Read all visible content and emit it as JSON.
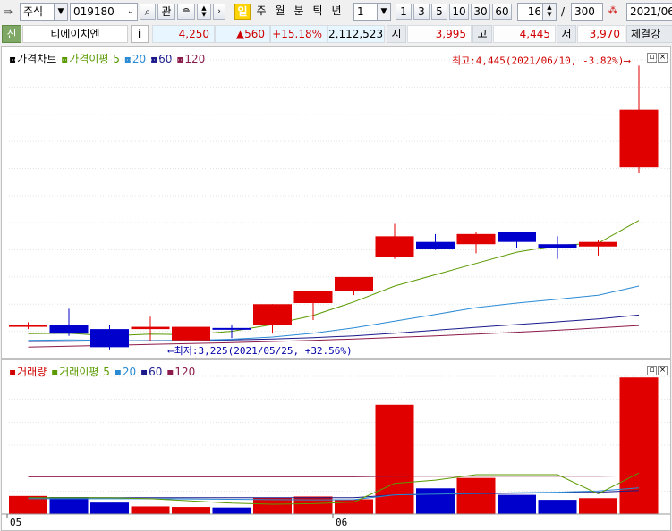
{
  "toolbar": {
    "market": "주식",
    "code": "019180",
    "watch_label": "관",
    "period_active": "일",
    "periods": [
      "주",
      "월",
      "분",
      "틱",
      "년"
    ],
    "unit_value": "1",
    "intervals": [
      "1",
      "3",
      "5",
      "10",
      "30",
      "60"
    ],
    "zoom_value": "16",
    "separator": "/",
    "count_value": "300",
    "date_value": "2021/06/"
  },
  "infobar": {
    "tag": "신",
    "stock_name": "티에이치엔",
    "info_label": "i",
    "price": "4,250",
    "change": "▲560",
    "change_pct": "+15.18%",
    "volume": "2,112,523",
    "open_label": "시",
    "open": "3,995",
    "high_label": "고",
    "high": "4,445",
    "low_label": "저",
    "low": "3,970",
    "trade_label": "체결강"
  },
  "price_pane": {
    "legend_title": "가격차트",
    "legend_ma_title": "가격이평",
    "ma_periods": [
      "5",
      "20",
      "60",
      "120"
    ],
    "high_annotation": "최고:4,445(2021/06/10, -3.82%)",
    "low_annotation": "최저:3,225(2021/05/25, +32.56%)"
  },
  "volume_pane": {
    "legend_title": "거래량",
    "legend_ma_title": "거래이평",
    "ma_periods": [
      "5",
      "20",
      "60",
      "120"
    ]
  },
  "colors": {
    "up": "#e00000",
    "down": "#0000cc",
    "ma5": "#5a9a00",
    "ma20": "#2a8ad4",
    "ma60": "#1a1a8c",
    "ma120": "#8c1a4a"
  },
  "chart_data": {
    "type": "candlestick",
    "x_axis_labels": [
      "05",
      "06"
    ],
    "x_axis_label_at": [
      0,
      8
    ],
    "candles": [
      {
        "open": 3290,
        "high": 3310,
        "low": 3280,
        "close": 3300
      },
      {
        "open": 3300,
        "high": 3370,
        "low": 3250,
        "close": 3260
      },
      {
        "open": 3280,
        "high": 3300,
        "low": 3190,
        "close": 3200
      },
      {
        "open": 3280,
        "high": 3335,
        "low": 3225,
        "close": 3290
      },
      {
        "open": 3230,
        "high": 3330,
        "low": 3180,
        "close": 3290
      },
      {
        "open": 3285,
        "high": 3300,
        "low": 3240,
        "close": 3280
      },
      {
        "open": 3300,
        "high": 3370,
        "low": 3260,
        "close": 3390
      },
      {
        "open": 3395,
        "high": 3435,
        "low": 3320,
        "close": 3450
      },
      {
        "open": 3450,
        "high": 3510,
        "low": 3430,
        "close": 3510
      },
      {
        "open": 3600,
        "high": 3745,
        "low": 3590,
        "close": 3690
      },
      {
        "open": 3665,
        "high": 3700,
        "low": 3630,
        "close": 3635
      },
      {
        "open": 3655,
        "high": 3710,
        "low": 3615,
        "close": 3700
      },
      {
        "open": 3710,
        "high": 3700,
        "low": 3640,
        "close": 3665
      },
      {
        "open": 3655,
        "high": 3690,
        "low": 3590,
        "close": 3640
      },
      {
        "open": 3645,
        "high": 3675,
        "low": 3605,
        "close": 3665
      },
      {
        "open": 3995,
        "high": 4445,
        "low": 3970,
        "close": 4250
      }
    ],
    "ma": {
      "5": [
        3260,
        3262,
        3250,
        3258,
        3255,
        3270,
        3300,
        3340,
        3400,
        3470,
        3520,
        3570,
        3620,
        3650,
        3660,
        3760
      ],
      "20": [
        3230,
        3232,
        3230,
        3228,
        3230,
        3235,
        3245,
        3262,
        3285,
        3315,
        3345,
        3375,
        3395,
        3412,
        3430,
        3470
      ],
      "60": [
        3225,
        3226,
        3228,
        3229,
        3230,
        3232,
        3236,
        3242,
        3250,
        3262,
        3275,
        3288,
        3300,
        3312,
        3325,
        3342
      ],
      "120": [
        3200,
        3204,
        3208,
        3212,
        3216,
        3220,
        3225,
        3230,
        3236,
        3243,
        3250,
        3258,
        3266,
        3275,
        3285,
        3296
      ]
    },
    "volume": [
      165000,
      155000,
      105000,
      70000,
      65000,
      60000,
      150000,
      160000,
      135000,
      1000000,
      235000,
      330000,
      175000,
      130000,
      145000,
      1250000
    ],
    "volume_ma": {
      "5": [
        150000,
        150000,
        150000,
        140000,
        120000,
        100000,
        90000,
        95000,
        110000,
        280000,
        310000,
        360000,
        360000,
        360000,
        185000,
        375000
      ],
      "20": [
        140000,
        140000,
        140000,
        140000,
        138000,
        135000,
        132000,
        130000,
        132000,
        175000,
        182000,
        188000,
        195000,
        200000,
        210000,
        240000
      ],
      "60": [
        150000,
        150000,
        150000,
        150000,
        150000,
        150000,
        150000,
        150000,
        150000,
        175000,
        180000,
        185000,
        190000,
        195000,
        200000,
        215000
      ],
      "120": [
        340000,
        340000,
        340000,
        340000,
        340000,
        340000,
        340000,
        340000,
        340000,
        345000,
        345000,
        345000,
        345000,
        345000,
        345000,
        350000
      ]
    },
    "y_range_price": [
      3150,
      4470
    ],
    "y_range_volume": [
      0,
      1260000
    ],
    "grid": true,
    "high": {
      "value": 4445,
      "date": "2021/06/10",
      "pct": "-3.82%",
      "index": 15
    },
    "low": {
      "value": 3225,
      "date": "2021/05/25",
      "pct": "+32.56%",
      "index": 3
    }
  }
}
